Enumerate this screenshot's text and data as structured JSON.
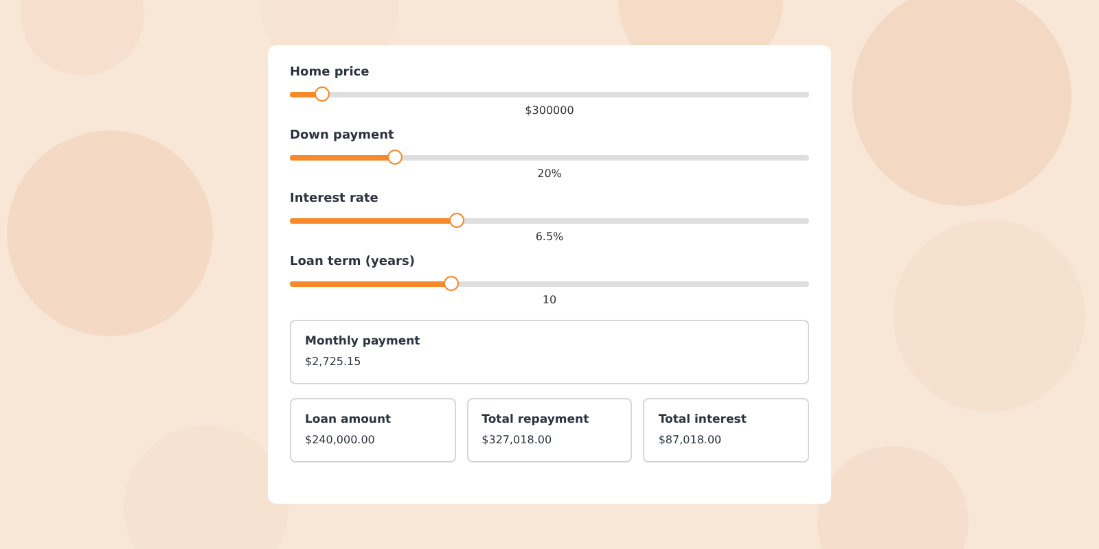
{
  "sliders": [
    {
      "label": "Home price",
      "level": 0.063,
      "reading": "$300000"
    },
    {
      "label": "Down payment",
      "level": 0.204,
      "reading": "20%"
    },
    {
      "label": "Interest rate",
      "level": 0.323,
      "reading": "6.5%"
    },
    {
      "label": "Loan term (years)",
      "level": 0.312,
      "reading": "10"
    }
  ],
  "monthly": {
    "label": "Monthly payment",
    "value": "$2,725.15"
  },
  "summary": [
    {
      "label": "Loan amount",
      "value": "$240,000.00"
    },
    {
      "label": "Total repayment",
      "value": "$327,018.00"
    },
    {
      "label": "Total interest",
      "value": "$87,018.00"
    }
  ]
}
